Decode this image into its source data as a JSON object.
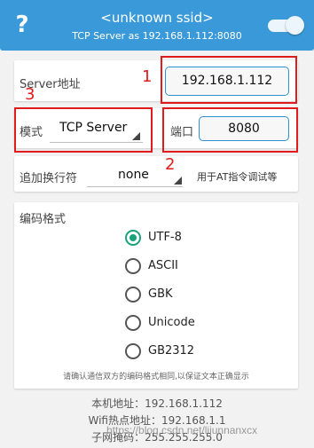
{
  "header": {
    "help_icon": "question-icon",
    "ssid": "<unknown ssid>",
    "server_line": "TCP Server as 192.168.1.112:8080",
    "toggle_on": true
  },
  "server": {
    "label": "Server地址",
    "ip": "192.168.1.112"
  },
  "mode": {
    "label": "模式",
    "value": "TCP Server"
  },
  "port": {
    "label": "端口",
    "value": "8080"
  },
  "newline": {
    "label": "追加换行符",
    "value": "none",
    "hint": "用于AT指令调试等"
  },
  "encoding": {
    "title": "编码格式",
    "options": [
      "UTF-8",
      "ASCII",
      "GBK",
      "Unicode",
      "GB2312"
    ],
    "selected": "UTF-8",
    "note": "请确认通信双方的编码格式相同,以保证文本正确显示"
  },
  "info": {
    "local_ip": "本机地址：192.168.1.112",
    "hotspot_ip": "Wifi热点地址：192.168.1.1",
    "subnet": "子网掩码：255.255.255.0"
  },
  "annotations": [
    "1",
    "2",
    "3"
  ],
  "watermark": "https://blog.csdn.net/lijunnanxcx",
  "colors": {
    "header": "#3a9ad9",
    "annotation_red": "#e01b1b",
    "radio_green": "#1aa37a"
  }
}
